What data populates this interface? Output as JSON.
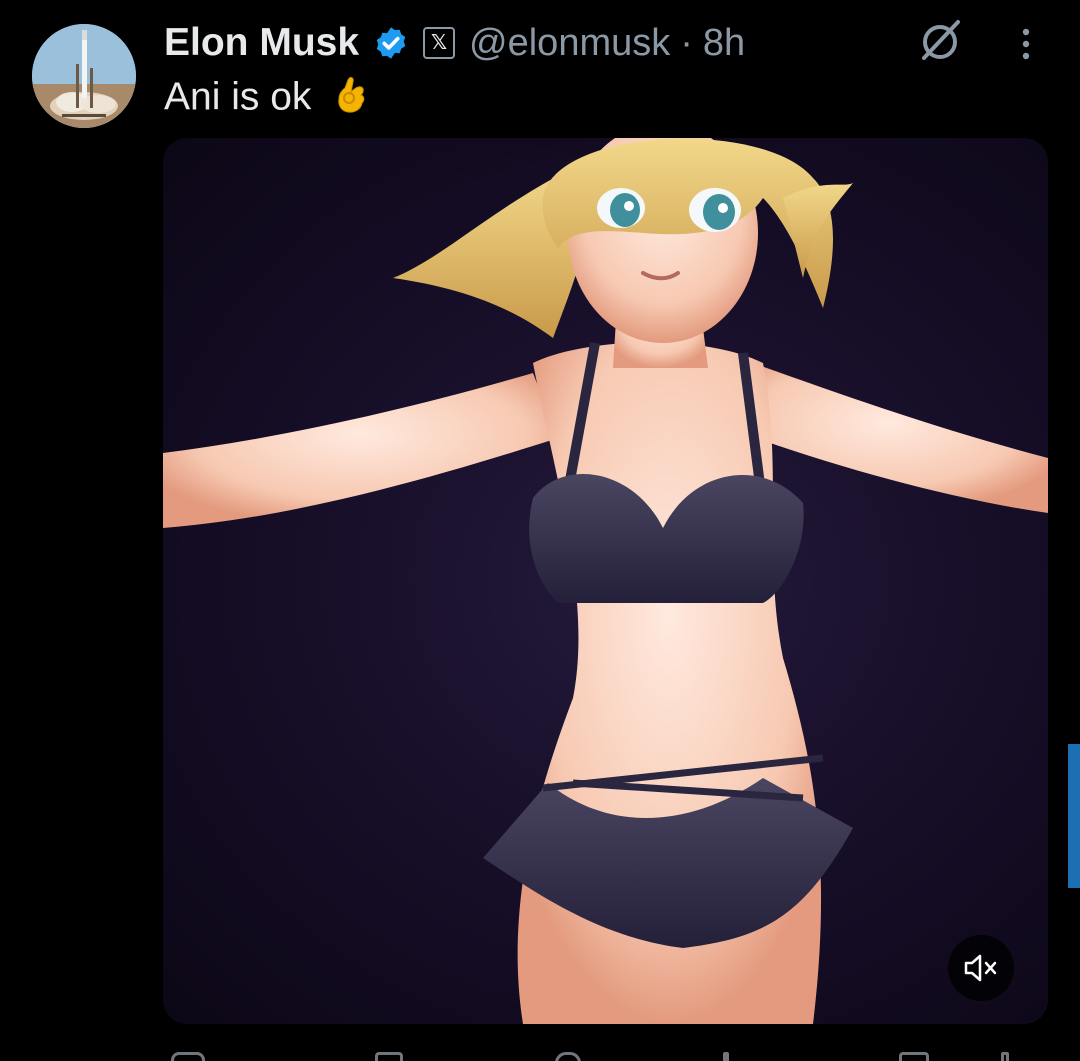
{
  "post": {
    "display_name": "Elon Musk",
    "handle": "@elonmusk",
    "separator": "·",
    "time": "8h",
    "text": "Ani is ok",
    "affiliate_glyph": "𝕏",
    "emoji_icon": "ok-hand-emoji-icon"
  },
  "icons": {
    "verified": "verified-badge-icon",
    "affiliate": "x-logo-icon",
    "grok": "grok-icon",
    "more": "more-vertical-icon",
    "mute": "volume-muted-icon"
  },
  "colors": {
    "background": "#000000",
    "primary_text": "#e7e9ea",
    "secondary_text": "#8b98a5",
    "verified_blue": "#1d9bf0",
    "scroll_indicator": "#1d6fb4"
  }
}
